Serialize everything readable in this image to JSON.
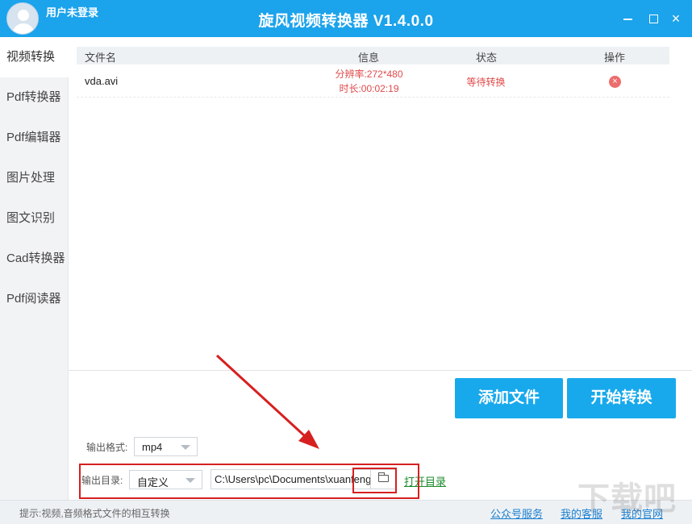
{
  "header": {
    "user_label": "用户未登录",
    "app_title": "旋风视频转换器 V1.4.0.0",
    "close_glyph": "×"
  },
  "sidebar": {
    "items": [
      {
        "label": "视频转换",
        "active": true
      },
      {
        "label": "Pdf转换器"
      },
      {
        "label": "Pdf编辑器"
      },
      {
        "label": "图片处理"
      },
      {
        "label": "图文识别"
      },
      {
        "label": "Cad转换器"
      },
      {
        "label": "Pdf阅读器"
      }
    ]
  },
  "file_list": {
    "columns": [
      "文件名",
      "信息",
      "状态",
      "操作"
    ],
    "rows": [
      {
        "name": "vda.avi",
        "info_line1": "分辨率:272*480",
        "info_line2": "时长:00:02:19",
        "status": "等待转换",
        "delete_glyph": "×"
      }
    ]
  },
  "buttons": {
    "add_file": "添加文件",
    "start_convert": "开始转换"
  },
  "output": {
    "format_label": "输出格式:",
    "format_value": "mp4",
    "dir_label": "输出目录:",
    "dir_mode": "自定义",
    "dir_path": "C:\\Users\\pc\\Documents\\xuanfeng",
    "open_dir": "打开目录"
  },
  "statusbar": {
    "hint": "提示:视频,音频格式文件的相互转换",
    "links": [
      "公众号服务",
      "我的客服",
      "我的官网"
    ]
  },
  "watermark": "下载吧",
  "colors": {
    "primary": "#1ba3ec",
    "button": "#18a9ec",
    "warning_text": "#e04a4a",
    "annotation": "#d62020",
    "link": "#1a7fd0",
    "open_dir_link": "#1b8a2a"
  }
}
